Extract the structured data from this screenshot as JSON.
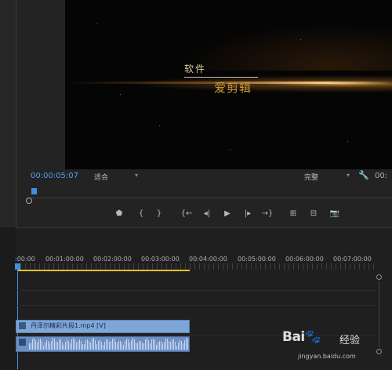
{
  "monitor": {
    "title_line1": "软件",
    "title_line2": "爱剪辑",
    "timecode": "00:00:05:07",
    "fit_select": "适合",
    "quality_select": "完整",
    "right_timecode": "00:"
  },
  "transport": {
    "icons": [
      "marker-icon",
      "in-point-icon",
      "out-point-icon",
      "go-to-in-icon",
      "step-back-icon",
      "play-icon",
      "step-forward-icon",
      "go-to-out-icon",
      "lift-icon",
      "extract-icon",
      "export-frame-icon"
    ]
  },
  "timeline": {
    "ruler_labels": [
      ":00:00",
      "00:01:00:00",
      "00:02:00:00",
      "00:03:00:00",
      "00:04:00:00",
      "00:05:00:00",
      "00:06:00:00",
      "00:07:00:00"
    ],
    "video_clip_label": "丹泽尔精彩片段1.mp4 [V]",
    "accent_blue": "#3f8fe0",
    "workarea_yellow": "#e6c12a"
  },
  "watermark": {
    "logo": "Bai",
    "logo_suffix": "经验",
    "url": "jingyan.baidu.com"
  }
}
